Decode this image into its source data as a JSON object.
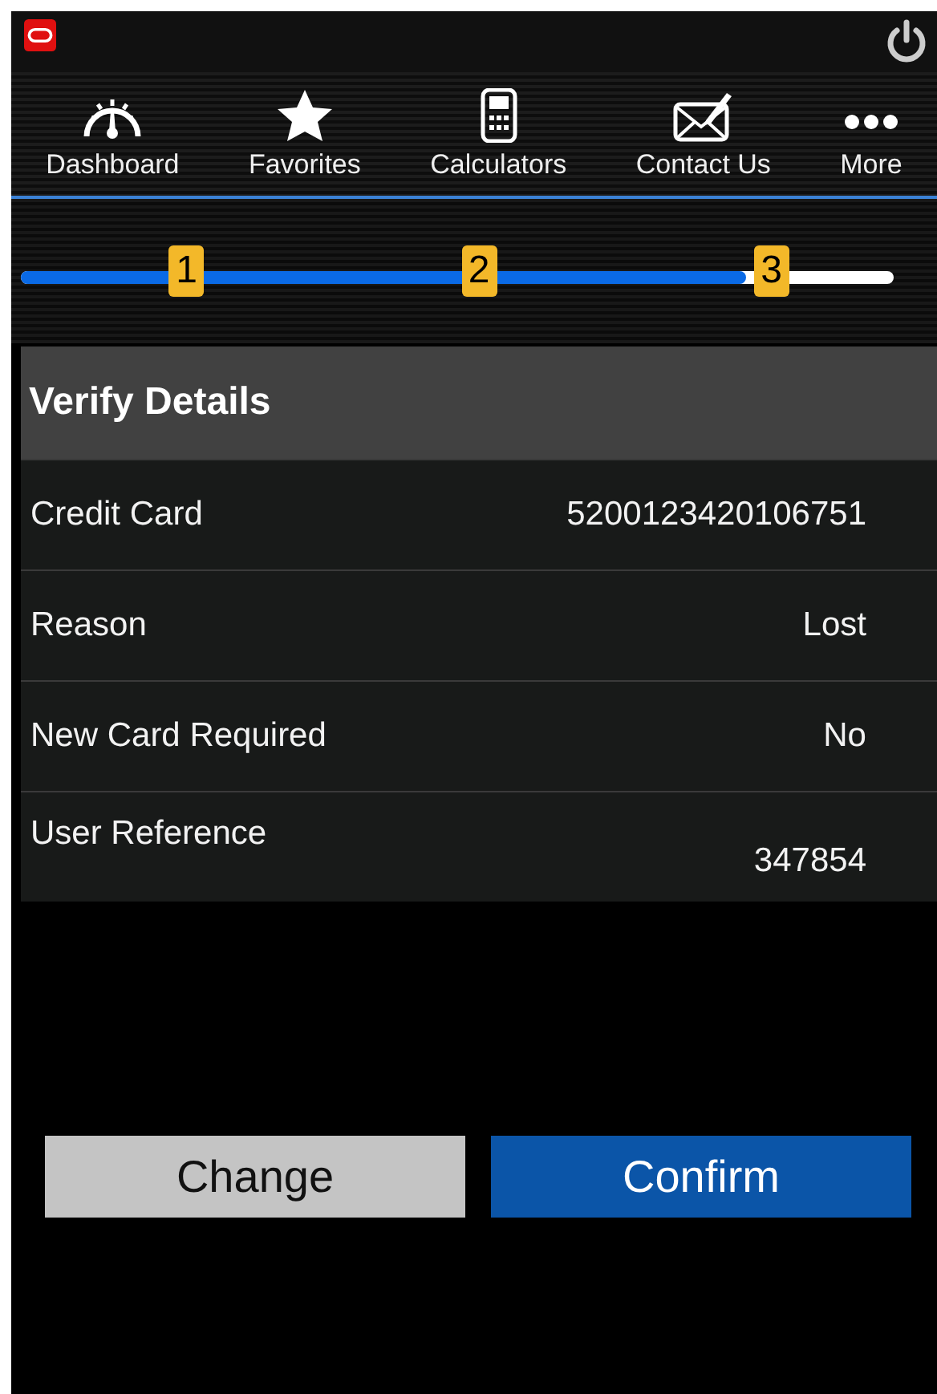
{
  "nav": [
    {
      "label": "Dashboard"
    },
    {
      "label": "Favorites"
    },
    {
      "label": "Calculators"
    },
    {
      "label": "Contact Us"
    },
    {
      "label": "More"
    }
  ],
  "progress": {
    "level": 0.83,
    "steps": [
      "1",
      "2",
      "3"
    ]
  },
  "section": {
    "title": "Verify Details"
  },
  "details": [
    {
      "label": "Credit Card",
      "value": "5200123420106751"
    },
    {
      "label": "Reason",
      "value": "Lost"
    },
    {
      "label": "New Card Required",
      "value": "No"
    },
    {
      "label": "User Reference",
      "value": "347854"
    }
  ],
  "buttons": [
    {
      "label": "Change",
      "kind": "secondary"
    },
    {
      "label": "Confirm",
      "kind": "primary"
    }
  ]
}
